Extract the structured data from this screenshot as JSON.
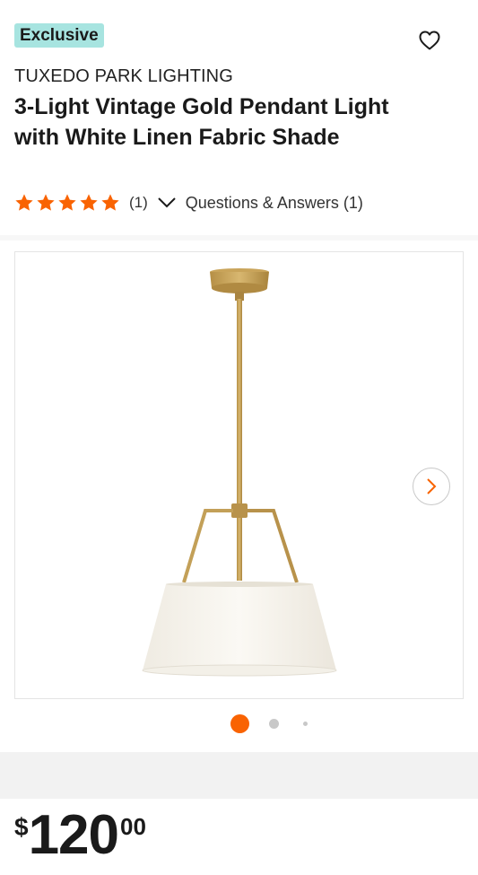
{
  "product": {
    "badge": "Exclusive",
    "brand": "TUXEDO PARK LIGHTING",
    "title": "3-Light Vintage Gold Pendant Light with White Linen Fabric Shade",
    "rating": {
      "stars": 5,
      "max": 5,
      "count_label": "(1)"
    },
    "qa_label": "Questions & Answers (1)"
  },
  "gallery": {
    "total_images": 3,
    "active_index": 0
  },
  "price": {
    "currency": "$",
    "dollars": "120",
    "cents": "00"
  },
  "icons": {
    "favorite": "heart-outline-icon",
    "expand": "chevron-down-icon",
    "next": "chevron-right-icon",
    "star": "star-icon"
  },
  "colors": {
    "accent": "#f96302",
    "badge_bg": "#a7e4e0",
    "gold": "#c9a45a",
    "shade": "#f6f3ec"
  }
}
